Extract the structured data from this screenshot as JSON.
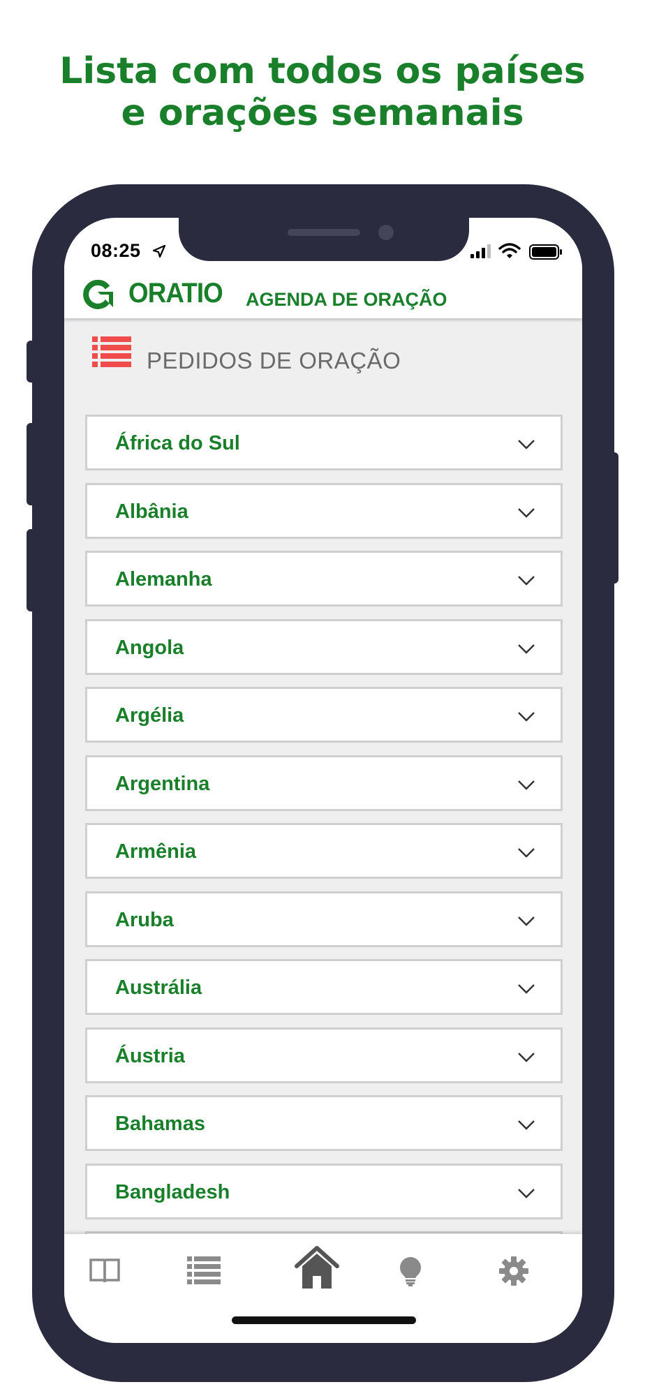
{
  "headline": {
    "line1": "Lista com todos os países",
    "line2": "e orações semanais"
  },
  "status_bar": {
    "time": "08:25"
  },
  "app_header": {
    "brand": "ORATIO",
    "title": "AGENDA DE ORAÇÃO"
  },
  "section": {
    "title": "PEDIDOS DE ORAÇÃO"
  },
  "countries": [
    "África do Sul",
    "Albânia",
    "Alemanha",
    "Angola",
    "Argélia",
    "Argentina",
    "Armênia",
    "Aruba",
    "Austrália",
    "Áustria",
    "Bahamas",
    "Bangladesh",
    ""
  ],
  "tabs": [
    {
      "icon": "book-icon",
      "active": false
    },
    {
      "icon": "list-icon",
      "active": false
    },
    {
      "icon": "home-icon",
      "active": true
    },
    {
      "icon": "lightbulb-icon",
      "active": false
    },
    {
      "icon": "gear-icon",
      "active": false
    }
  ],
  "colors": {
    "brand_green": "#1a7f2a",
    "accent_red": "#ee4b4b",
    "phone_frame": "#2b2b40",
    "content_bg": "#f0eff0",
    "icon_gray": "#8a8a8a",
    "active_icon": "#555555"
  }
}
